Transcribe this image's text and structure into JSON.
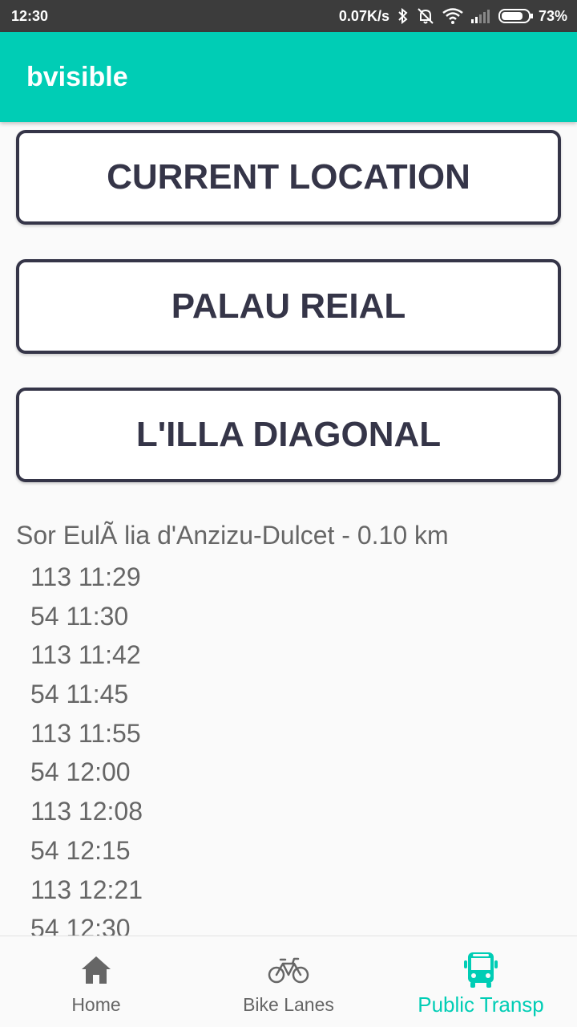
{
  "status_bar": {
    "time": "12:30",
    "network_speed": "0.07K/s",
    "battery": "73%",
    "icons": [
      "bluetooth-icon",
      "bell-off-icon",
      "wifi-icon",
      "signal-icon",
      "battery-icon"
    ]
  },
  "app_bar": {
    "title": "bvisible"
  },
  "locations": [
    {
      "label": "CURRENT LOCATION"
    },
    {
      "label": "PALAU REIAL"
    },
    {
      "label": "L'ILLA DIAGONAL"
    }
  ],
  "stop": {
    "title": "Sor EulÃ lia d'Anzizu-Dulcet - 0.10 km",
    "arrivals": [
      "113 11:29",
      "54 11:30",
      "113 11:42",
      "54 11:45",
      "113 11:55",
      "54 12:00",
      "113 12:08",
      "54 12:15",
      "113 12:21",
      "54 12:30"
    ]
  },
  "bottom_nav": {
    "items": [
      {
        "label": "Home",
        "icon": "home-icon"
      },
      {
        "label": "Bike Lanes",
        "icon": "bike-icon"
      },
      {
        "label": "Public Transp",
        "icon": "bus-icon",
        "active": true
      }
    ]
  },
  "colors": {
    "accent": "#00cdb5",
    "status_bar": "#3c3c3c",
    "button_border": "#353548",
    "text_muted": "#666666"
  }
}
